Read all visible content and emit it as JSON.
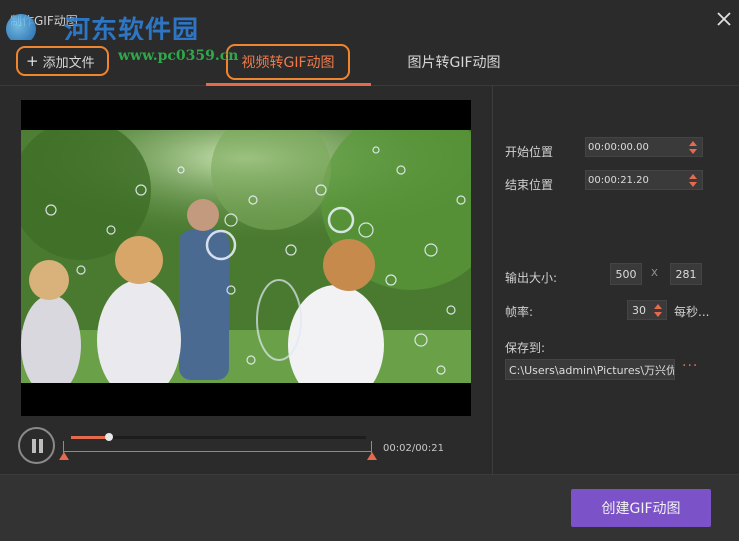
{
  "window": {
    "title": "制作GIF动图",
    "close_icon": "close-icon"
  },
  "watermark": {
    "text": "河东软件园",
    "url": "www.pc0359.cn"
  },
  "toolbar": {
    "add_file_label": "添加文件",
    "add_file_icon": "+",
    "tabs": [
      {
        "label": "视频转GIF动图",
        "active": true
      },
      {
        "label": "图片转GIF动图",
        "active": false
      }
    ]
  },
  "player": {
    "time_display": "00:02/00:21",
    "progress": 0.13,
    "state": "playing"
  },
  "settings": {
    "start_label": "开始位置",
    "start_value": "00:00:00.00",
    "end_label": "结束位置",
    "end_value": "00:00:21.20",
    "output_size_label": "输出大小:",
    "width": "500",
    "size_separator": "X",
    "height": "281",
    "fps_label": "帧率:",
    "fps_value": "30",
    "fps_unit": "每秒...",
    "save_to_label": "保存到:",
    "save_path": "C:\\Users\\admin\\Pictures\\万兴优",
    "browse_label": "···"
  },
  "footer": {
    "create_label": "创建GIF动图"
  },
  "colors": {
    "accent": "#e46a4e",
    "highlight": "#f0852f",
    "primary_button": "#7b52c7",
    "background": "#2b2b2b"
  }
}
